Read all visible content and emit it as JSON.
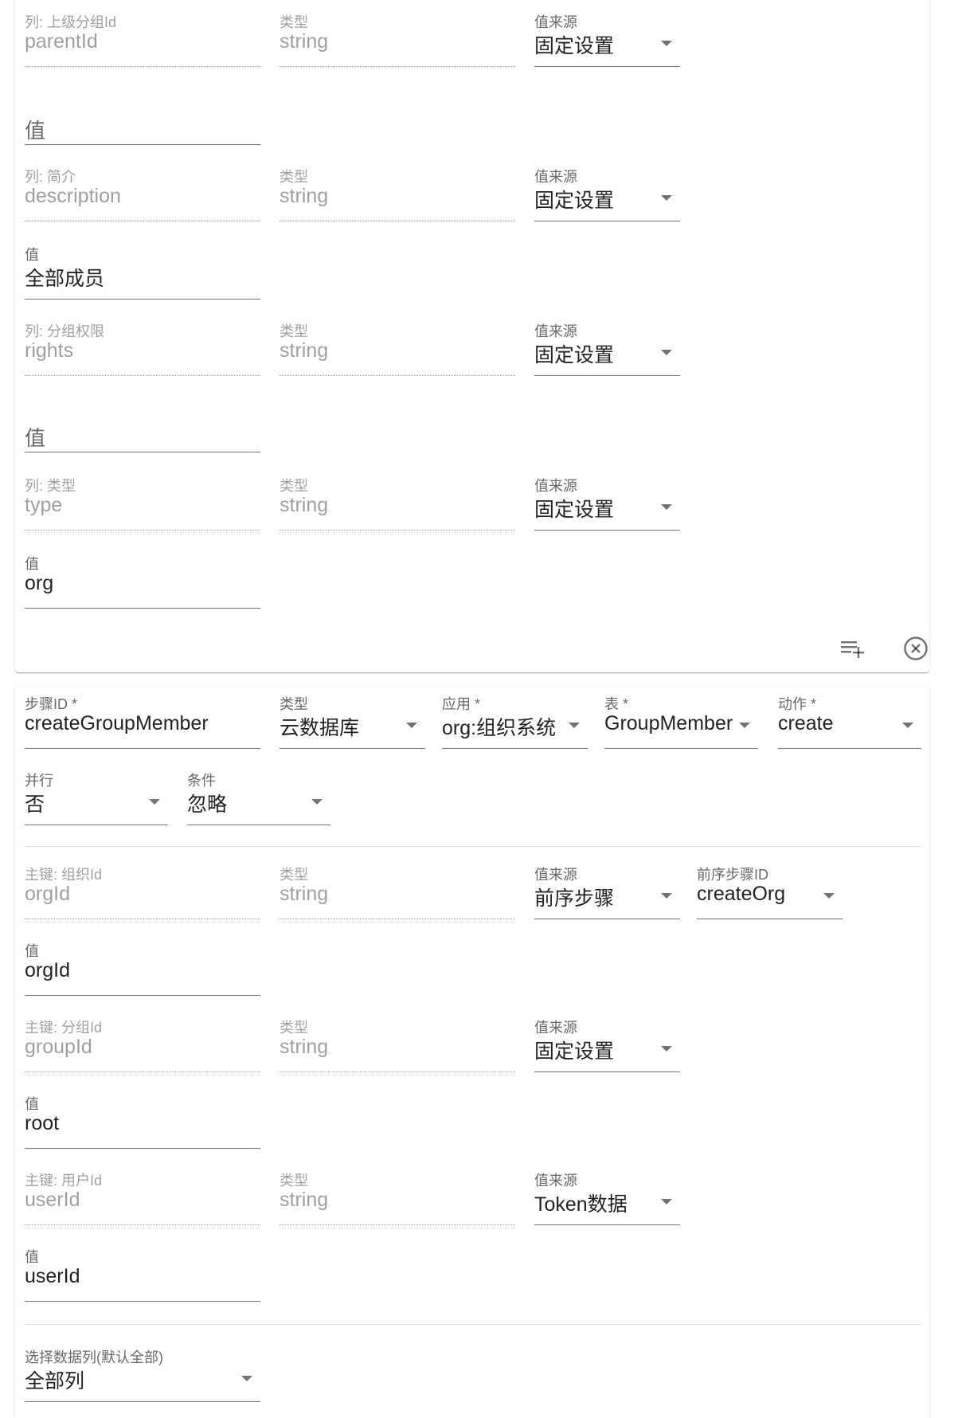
{
  "card1": {
    "rows": [
      {
        "column": {
          "label": "列: 上级分组Id",
          "value": "parentId"
        },
        "type": {
          "label": "类型",
          "value": "string"
        },
        "source": {
          "label": "值来源",
          "value": "固定设置"
        },
        "value_field": {
          "label": "",
          "value": "",
          "placeholder": "值"
        }
      },
      {
        "column": {
          "label": "列: 简介",
          "value": "description"
        },
        "type": {
          "label": "类型",
          "value": "string"
        },
        "source": {
          "label": "值来源",
          "value": "固定设置"
        },
        "value_field": {
          "label": "值",
          "value": "全部成员"
        }
      },
      {
        "column": {
          "label": "列: 分组权限",
          "value": "rights"
        },
        "type": {
          "label": "类型",
          "value": "string"
        },
        "source": {
          "label": "值来源",
          "value": "固定设置"
        },
        "value_field": {
          "label": "",
          "value": "",
          "placeholder": "值"
        }
      },
      {
        "column": {
          "label": "列: 类型",
          "value": "type"
        },
        "type": {
          "label": "类型",
          "value": "string"
        },
        "source": {
          "label": "值来源",
          "value": "固定设置"
        },
        "value_field": {
          "label": "值",
          "value": "org"
        }
      }
    ],
    "actions": {
      "add_icon": "playlist-add-icon",
      "remove_icon": "close-circle-icon"
    }
  },
  "card2": {
    "step_id": {
      "label": "步骤ID *",
      "value": "createGroupMember"
    },
    "step_type": {
      "label": "类型",
      "value": "云数据库"
    },
    "app": {
      "label": "应用 *",
      "value": "org:组织系统"
    },
    "table": {
      "label": "表 *",
      "value": "GroupMember"
    },
    "action": {
      "label": "动作 *",
      "value": "create"
    },
    "parallel": {
      "label": "并行",
      "value": "否"
    },
    "condition": {
      "label": "条件",
      "value": "忽略"
    },
    "keys": [
      {
        "column": {
          "label": "主键: 组织Id",
          "value": "orgId"
        },
        "type": {
          "label": "类型",
          "value": "string"
        },
        "source": {
          "label": "值来源",
          "value": "前序步骤"
        },
        "prev_step": {
          "label": "前序步骤ID",
          "value": "createOrg"
        },
        "value_field": {
          "label": "值",
          "value": "orgId"
        }
      },
      {
        "column": {
          "label": "主键: 分组Id",
          "value": "groupId"
        },
        "type": {
          "label": "类型",
          "value": "string"
        },
        "source": {
          "label": "值来源",
          "value": "固定设置"
        },
        "value_field": {
          "label": "值",
          "value": "root"
        }
      },
      {
        "column": {
          "label": "主键: 用户Id",
          "value": "userId"
        },
        "type": {
          "label": "类型",
          "value": "string"
        },
        "source": {
          "label": "值来源",
          "value": "Token数据"
        },
        "value_field": {
          "label": "值",
          "value": "userId"
        }
      }
    ],
    "columns_select": {
      "label": "选择数据列(默认全部)",
      "value": "全部列"
    }
  }
}
